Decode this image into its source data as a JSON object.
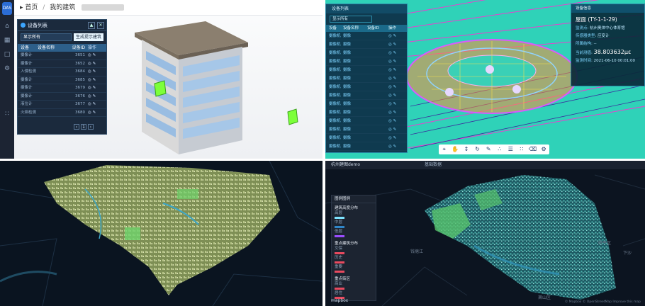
{
  "panel_a": {
    "logo_text": "DAS",
    "nav_icons": [
      "home-icon",
      "folder-icon",
      "file-icon",
      "settings-icon",
      "grid-icon"
    ],
    "breadcrumb": [
      "首页",
      "/",
      "我的建筑"
    ],
    "device_list": {
      "title": "设备列表",
      "filter_value": "显示所有",
      "generate_button": "生成提示建筑",
      "columns": [
        "设备",
        "设备名称",
        "设备ID",
        "操作"
      ],
      "rows": [
        {
          "type": "摄像计",
          "id": "3651"
        },
        {
          "type": "摄像计",
          "id": "3652"
        },
        {
          "type": "入侵检测",
          "id": "3684"
        },
        {
          "type": "摄像计",
          "id": "3685"
        },
        {
          "type": "摄像计",
          "id": "3679"
        },
        {
          "type": "摄像计",
          "id": "3676"
        },
        {
          "type": "液位计",
          "id": "3677"
        },
        {
          "type": "火焰检测",
          "id": "3680"
        }
      ],
      "current_page": "1"
    }
  },
  "panel_b": {
    "list": {
      "title": "设备列表",
      "filter_value": "显示所有",
      "columns": [
        "设备",
        "设备名称",
        "设备ID",
        "操作"
      ],
      "row_type": "摄像机",
      "row_name": "摄像",
      "row_count": 14
    },
    "info": {
      "title": "设备信息",
      "code": "屋面 (TY-1-1-29)",
      "rows": [
        {
          "k": "监测点",
          "v": "杭州奥体中心体育馆"
        },
        {
          "k": "传感器类型",
          "v": "应变计"
        },
        {
          "k": "所属结构",
          "v": "--"
        },
        {
          "k": "当前测值",
          "v": "38.803632με"
        },
        {
          "k": "监测时间",
          "v": "2021-06-10 00:01:00"
        }
      ]
    },
    "toolbar_icons": [
      "cursor-icon",
      "hand-icon",
      "move-icon",
      "rotate-icon",
      "pen-icon",
      "nodes-icon",
      "layers-icon",
      "cluster-icon",
      "trash-icon",
      "gear-icon"
    ]
  },
  "panel_d": {
    "top_bar_title": "杭州建图demo",
    "top_bar_tab": "基础数据",
    "legend": {
      "title": "图例图例",
      "groups": [
        {
          "title": "建筑高度分布",
          "items": [
            "高层",
            "中层",
            "低层"
          ],
          "colors": [
            "#7de3ff",
            "#2f86c9",
            "#9b4dff"
          ]
        },
        {
          "title": "重点建筑分布",
          "items": [
            "文保",
            "历史",
            "重要"
          ],
          "colors": [
            "#e84a5f",
            "#e84a5f",
            "#e84a5f"
          ]
        },
        {
          "title": "重点街区",
          "items": [
            "商业",
            "居住"
          ],
          "colors": [
            "#e84a5f",
            "#e84a5f"
          ]
        }
      ]
    },
    "map_labels": [
      "钱塘江",
      "下沙",
      "临平区",
      "萧山区"
    ],
    "mapbox_logo": "mapbox",
    "attribution": "© Mapbox © OpenStreetMap Improve this map"
  },
  "colors": {
    "panel_a_bg": "#f4f5f7",
    "panel_b_bg": "#2fd2b8",
    "dark_map": "#0a1420",
    "accent_blue": "#2b6cd4"
  }
}
